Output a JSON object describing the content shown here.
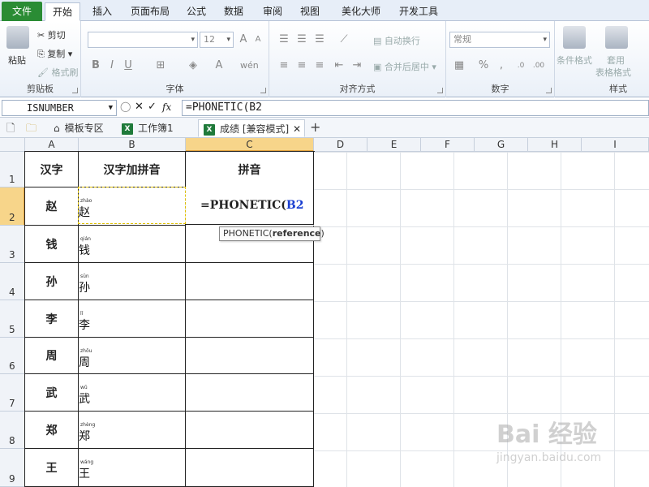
{
  "ribbon_tabs": [
    "文件",
    "开始",
    "插入",
    "页面布局",
    "公式",
    "数据",
    "审阅",
    "视图",
    "美化大师",
    "开发工具"
  ],
  "clipboard": {
    "paste": "粘贴",
    "cut": "剪切",
    "copy": "复制",
    "format_painter": "格式刷",
    "group": "剪贴板"
  },
  "font": {
    "size": "12",
    "group": "字体",
    "bold": "B",
    "italic": "I",
    "underline": "U",
    "grow": "A",
    "shrink": "A",
    "font_color": "A"
  },
  "alignment": {
    "wrap": "自动换行",
    "merge": "合并后居中",
    "group": "对齐方式"
  },
  "number": {
    "format": "常规",
    "percent": "%",
    "comma": ",",
    "group": "数字"
  },
  "styles": {
    "conditional": "条件格式",
    "table_line1": "套用",
    "table_line2": "表格格式",
    "group": "样式"
  },
  "formula_bar": {
    "name_box": "ISNUMBER",
    "fx": "fx",
    "formula": "=PHONETIC(B2"
  },
  "doc_tabs": {
    "template": "模板专区",
    "workbook1": "工作簿1",
    "current": "成绩 [兼容模式]",
    "add": "+"
  },
  "columns": [
    "A",
    "B",
    "C",
    "D",
    "E",
    "F",
    "G",
    "H",
    "I"
  ],
  "rows": [
    "1",
    "2",
    "3",
    "4",
    "5",
    "6",
    "7",
    "8",
    "9"
  ],
  "headers": {
    "a": "汉字",
    "b": "汉字加拼音",
    "c": "拼音"
  },
  "names": [
    {
      "char": "赵",
      "pinyin": "zhào"
    },
    {
      "char": "钱",
      "pinyin": "qián"
    },
    {
      "char": "孙",
      "pinyin": "sūn"
    },
    {
      "char": "李",
      "pinyin": "lǐ"
    },
    {
      "char": "周",
      "pinyin": "zhōu"
    },
    {
      "char": "武",
      "pinyin": "wǔ"
    },
    {
      "char": "郑",
      "pinyin": "zhèng"
    },
    {
      "char": "王",
      "pinyin": "wáng"
    }
  ],
  "active_cell": {
    "prefix": "=PHONETIC(",
    "reference": "B2"
  },
  "tooltip": {
    "fn": "PHONETIC(",
    "arg": "reference",
    "close": ")"
  },
  "watermark": {
    "line1": "Bai 经验",
    "line2": "jingyan.baidu.com"
  },
  "colors": {
    "file_tab": "#2a8c34",
    "selected_header": "#f7d58a",
    "reference": "#1a3fd1"
  }
}
